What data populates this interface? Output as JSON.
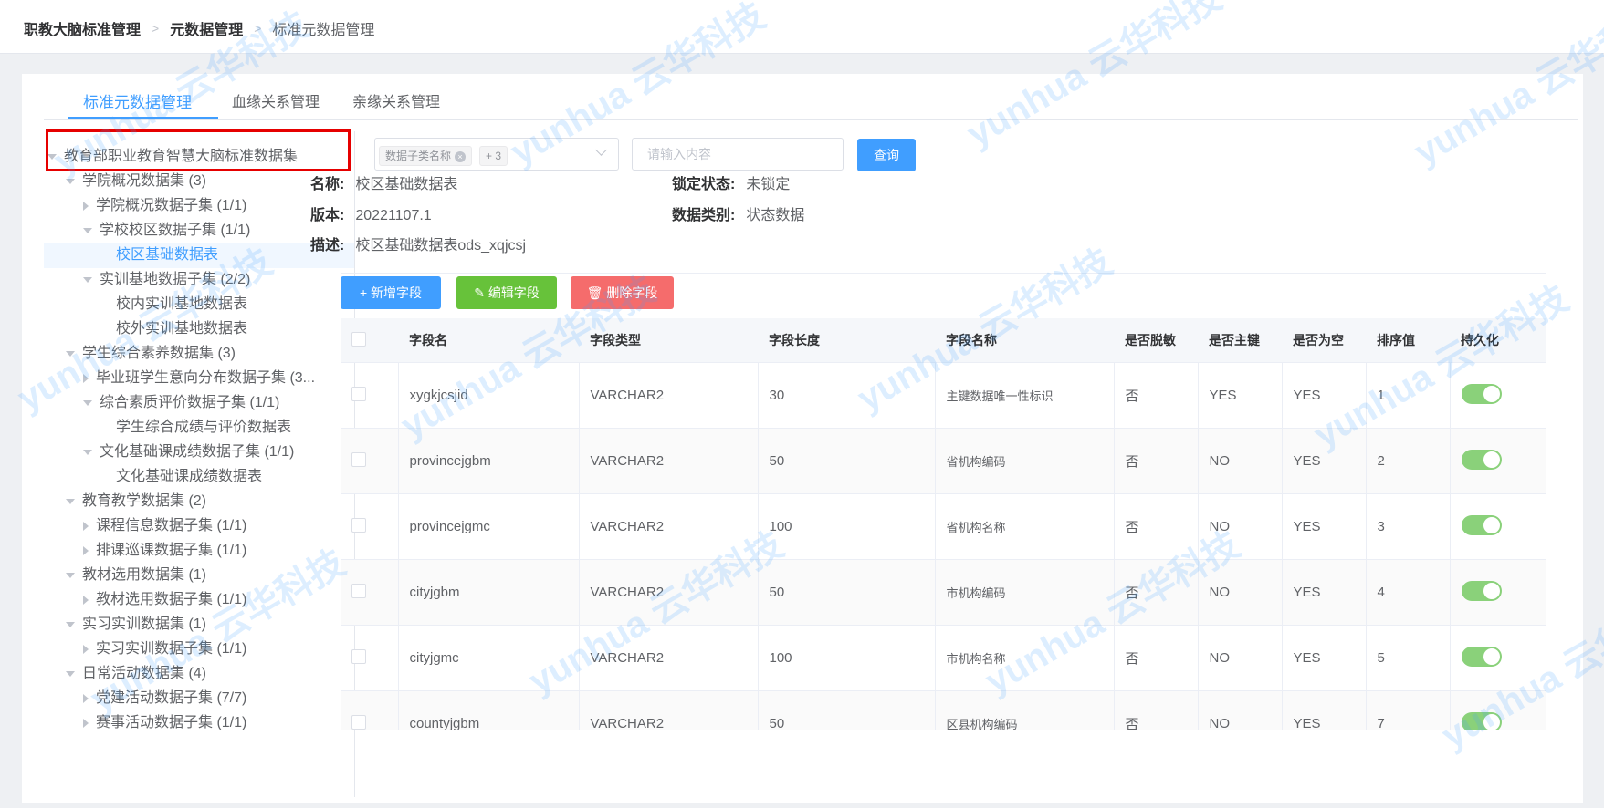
{
  "breadcrumb": {
    "item1": "职教大脑标准管理",
    "item2": "元数据管理",
    "item3": "标准元数据管理",
    "sep": ">"
  },
  "tabs": [
    "标准元数据管理",
    "血缘关系管理",
    "亲缘关系管理"
  ],
  "tree": {
    "root": "教育部职业教育智慧大脑标准数据集",
    "nodes": [
      "学院概况数据集 (3)",
      "学院概况数据子集 (1/1)",
      "学校校区数据子集 (1/1)",
      "校区基础数据表",
      "实训基地数据子集 (2/2)",
      "校内实训基地数据表",
      "校外实训基地数据表",
      "学生综合素养数据集 (3)",
      "毕业班学生意向分布数据子集 (3...",
      "综合素质评价数据子集 (1/1)",
      "学生综合成绩与评价数据表",
      "文化基础课成绩数据子集 (1/1)",
      "文化基础课成绩数据表",
      "教育教学数据集 (2)",
      "课程信息数据子集 (1/1)",
      "排课巡课数据子集 (1/1)",
      "教材选用数据集 (1)",
      "教材选用数据子集 (1/1)",
      "实习实训数据集 (1)",
      "实习实训数据子集 (1/1)",
      "日常活动数据集 (4)",
      "党建活动数据子集 (7/7)",
      "赛事活动数据子集 (1/1)"
    ]
  },
  "filter": {
    "chip_label": "数据子类名称",
    "chip_more": "+ 3",
    "input_placeholder": "请输入内容",
    "query_label": "查询"
  },
  "info": {
    "name_key": "名称:",
    "name_val": "校区基础数据表",
    "version_key": "版本:",
    "version_val": "20221107.1",
    "desc_key": "描述:",
    "desc_val": "校区基础数据表ods_xqjcsj",
    "lock_key": "锁定状态:",
    "lock_val": "未锁定",
    "cat_key": "数据类别:",
    "cat_val": "状态数据"
  },
  "actions": {
    "add": "+ 新增字段",
    "edit": "编辑字段",
    "delete": "删除字段"
  },
  "colors": {
    "primary": "#409eff",
    "success": "#67c23a",
    "danger": "#f56c6c",
    "switch_on": "#8ad17a"
  },
  "table": {
    "headers": [
      "字段名",
      "字段类型",
      "字段长度",
      "字段名称",
      "是否脱敏",
      "是否主键",
      "是否为空",
      "排序值",
      "持久化"
    ],
    "rows": [
      {
        "name": "xygkjcsjid",
        "type": "VARCHAR2",
        "len": "30",
        "cname": "主键数据唯一性标识",
        "mask": "否",
        "pk": "YES",
        "nullable": "YES",
        "order": "1"
      },
      {
        "name": "provincejgbm",
        "type": "VARCHAR2",
        "len": "50",
        "cname": "省机构编码",
        "mask": "否",
        "pk": "NO",
        "nullable": "YES",
        "order": "2"
      },
      {
        "name": "provincejgmc",
        "type": "VARCHAR2",
        "len": "100",
        "cname": "省机构名称",
        "mask": "否",
        "pk": "NO",
        "nullable": "YES",
        "order": "3"
      },
      {
        "name": "cityjgbm",
        "type": "VARCHAR2",
        "len": "50",
        "cname": "市机构编码",
        "mask": "否",
        "pk": "NO",
        "nullable": "YES",
        "order": "4"
      },
      {
        "name": "cityjgmc",
        "type": "VARCHAR2",
        "len": "100",
        "cname": "市机构名称",
        "mask": "否",
        "pk": "NO",
        "nullable": "YES",
        "order": "5"
      },
      {
        "name": "countyjgbm",
        "type": "VARCHAR2",
        "len": "50",
        "cname": "区县机构编码",
        "mask": "否",
        "pk": "NO",
        "nullable": "YES",
        "order": "7"
      }
    ]
  },
  "watermark": "yunhua 云华科技"
}
